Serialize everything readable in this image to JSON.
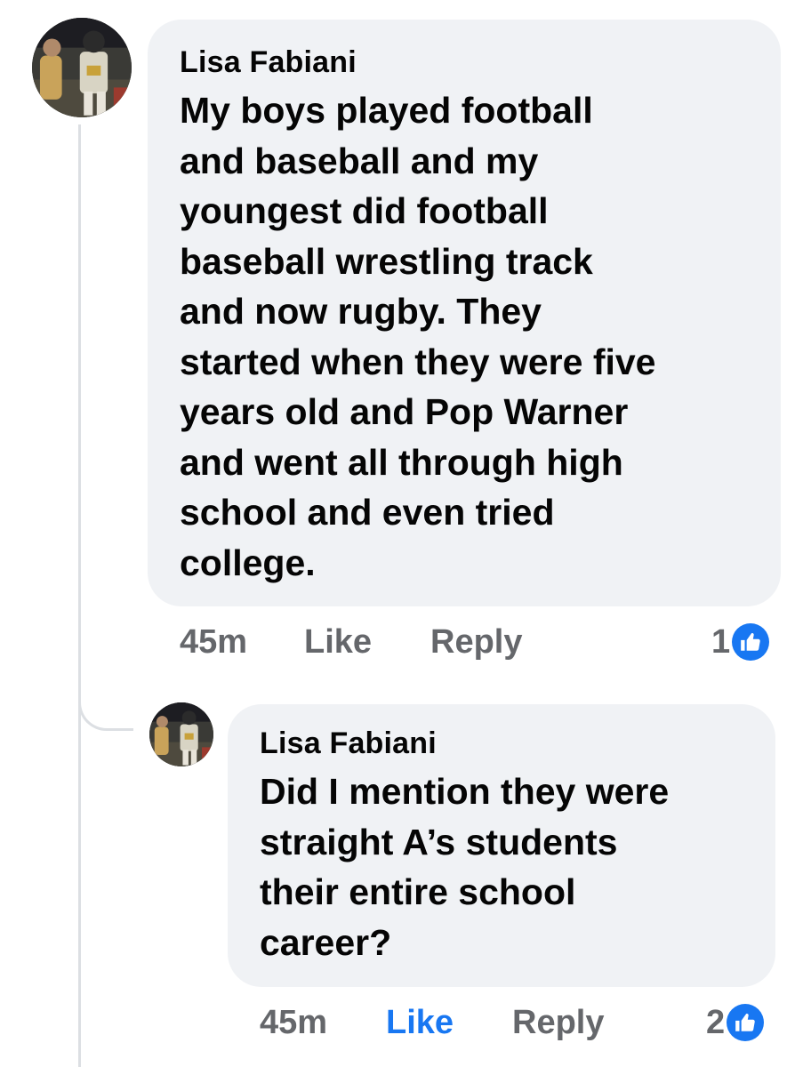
{
  "comment": {
    "author": "Lisa Fabiani",
    "text": "My boys played football\nand baseball and my\nyoungest did football\nbaseball wrestling track\nand now rugby. They\nstarted when they were five\nyears old and Pop Warner\nand went all through high\nschool and even tried\ncollege.",
    "time": "45m",
    "like_label": "Like",
    "reply_label": "Reply",
    "reaction_count": "1",
    "reaction_icon": "thumbs-up-icon",
    "liked_by_me": false
  },
  "reply": {
    "author": "Lisa Fabiani",
    "text": "Did I mention they were\nstraight A’s students\ntheir entire school\ncareer?",
    "time": "45m",
    "like_label": "Like",
    "reply_label": "Reply",
    "reaction_count": "2",
    "reaction_icon": "thumbs-up-icon",
    "liked_by_me": true
  },
  "colors": {
    "bubble_bg": "#f0f2f5",
    "meta_text": "#65676b",
    "accent_blue": "#1877f2",
    "thread_line": "#dcdfe3"
  }
}
